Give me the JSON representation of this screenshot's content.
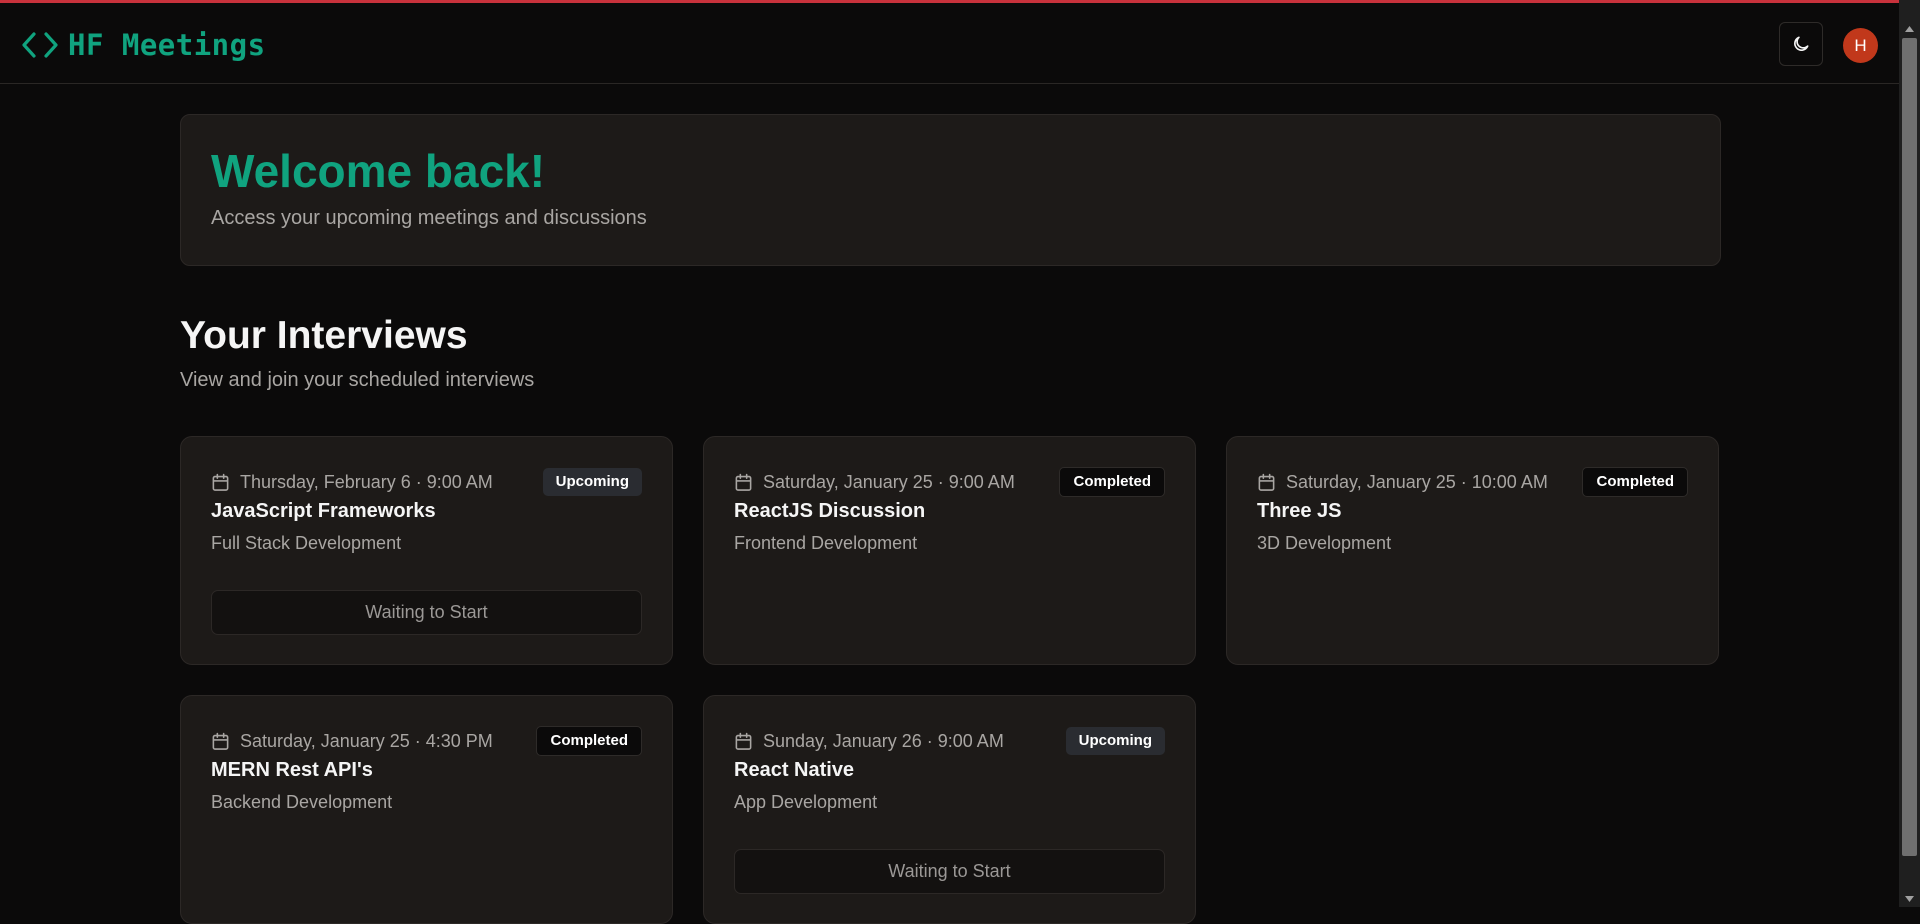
{
  "header": {
    "logo_text": "HF Meetings",
    "avatar_initial": "H"
  },
  "welcome": {
    "title": "Welcome back!",
    "subtitle": "Access your upcoming meetings and discussions"
  },
  "interviews": {
    "title": "Your Interviews",
    "subtitle": "View and join your scheduled interviews",
    "cards": [
      {
        "date": "Thursday, February 6 · 9:00 AM",
        "status": "Upcoming",
        "title": "JavaScript Frameworks",
        "subtitle": "Full Stack Development",
        "action": "Waiting to Start"
      },
      {
        "date": "Saturday, January 25 · 9:00 AM",
        "status": "Completed",
        "title": "ReactJS Discussion",
        "subtitle": "Frontend Development"
      },
      {
        "date": "Saturday, January 25 · 10:00 AM",
        "status": "Completed",
        "title": "Three JS",
        "subtitle": "3D Development"
      },
      {
        "date": "Saturday, January 25 · 4:30 PM",
        "status": "Completed",
        "title": "MERN Rest API's",
        "subtitle": "Backend Development"
      },
      {
        "date": "Sunday, January 26 · 9:00 AM",
        "status": "Upcoming",
        "title": "React Native",
        "subtitle": "App Development",
        "action": "Waiting to Start"
      }
    ]
  },
  "colors": {
    "accent": "#10a37f",
    "avatar_bg": "#c1381b",
    "top_border": "#c8323c"
  }
}
